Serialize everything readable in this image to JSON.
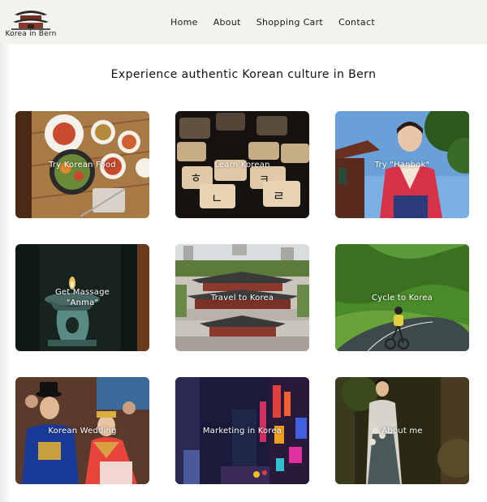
{
  "header": {
    "logo_text": "Korea in Bern",
    "nav": [
      "Home",
      "About",
      "Shopping Cart",
      "Contact"
    ]
  },
  "main": {
    "title": "Experience authentic Korean culture in Bern",
    "cards": [
      {
        "label": "Try Korean Food",
        "image": "korean-food-table"
      },
      {
        "label": "Learn Korean",
        "image": "hangul-letter-tiles"
      },
      {
        "label": "Try \"Hanbok\"",
        "image": "woman-in-hanbok"
      },
      {
        "label": "Get Massage \"Anma\"",
        "image": "aroma-oil-burner"
      },
      {
        "label": "Travel to Korea",
        "image": "palace-and-city"
      },
      {
        "label": "Cycle to Korea",
        "image": "cyclist-mountain-road"
      },
      {
        "label": "Korean Wedding",
        "image": "traditional-wedding"
      },
      {
        "label": "Marketing in Korea",
        "image": "seoul-night-street"
      },
      {
        "label": "About me",
        "image": "woman-in-forest"
      }
    ]
  }
}
